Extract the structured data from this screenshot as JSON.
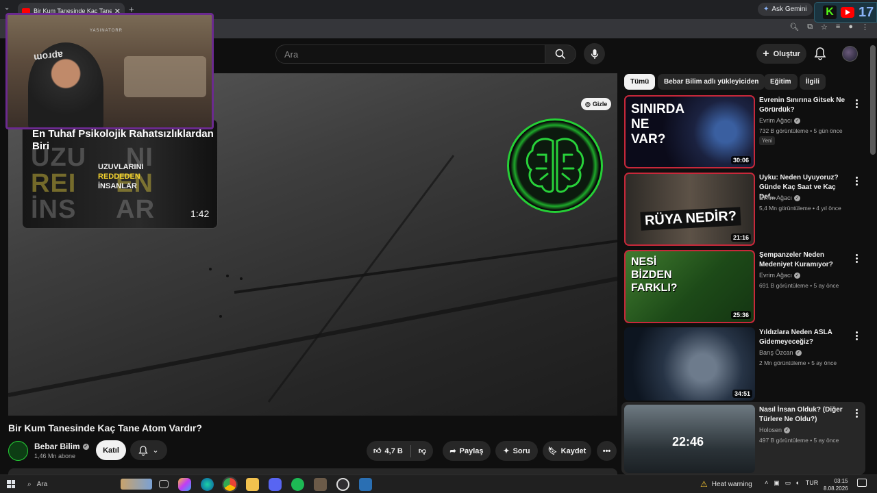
{
  "browser": {
    "tab_title": "Bir Kum Tanesinde Kaç Tane Atom Vardır?",
    "ask_gemini": "Ask Gemini",
    "extension_count": "17"
  },
  "header": {
    "search_placeholder": "Ara",
    "create_label": "Oluştur"
  },
  "player": {
    "hide_label": "Gizle",
    "overlay_card": {
      "title": "En Tuhaf Psikolojik Rahatsızlıklardan Biri",
      "thumb_line1": "UZUVLARINI",
      "thumb_line2": "REDDEDEN",
      "thumb_line3": "İNSANLAR",
      "duration": "1:42"
    },
    "cam_label": "YASINATORR"
  },
  "video": {
    "title": "Bir Kum Tanesinde Kaç Tane Atom Vardır?",
    "channel": "Bebar Bilim",
    "subscribers": "1,46 Mn abone",
    "join_label": "Katıl",
    "likes": "4,7 B",
    "share_label": "Paylaş",
    "ask_label": "Soru",
    "save_label": "Kaydet"
  },
  "chips": [
    "Tümü",
    "Bebar Bilim adlı yükleyiciden",
    "Eğitim",
    "İlgili"
  ],
  "recommendations": [
    {
      "title": "Evrenin Sınırına Gitsek Ne Görürdük?",
      "channel": "Evrim Ağacı",
      "meta": "732 B görüntüleme • 5 gün önce",
      "badge": "Yeni",
      "duration": "30:06",
      "thumb_text": "SINIRDA NE VAR?"
    },
    {
      "title": "Uyku: Neden Uyuyoruz? Günde Kaç Saat ve Kaç Def...",
      "channel": "Evrim Ağacı",
      "meta": "5,4 Mn görüntüleme • 4 yıl önce",
      "duration": "21:16",
      "thumb_text": "RÜYA NEDİR?"
    },
    {
      "title": "Şempanzeler Neden Medeniyet Kuramıyor?",
      "channel": "Evrim Ağacı",
      "meta": "691 B görüntüleme • 5 ay önce",
      "duration": "25:36",
      "thumb_text": "NESİ BİZDEN FARKLI?"
    },
    {
      "title": "Yıldızlara Neden ASLA Gidemeyeceğiz?",
      "channel": "Barış Özcan",
      "meta": "2 Mn görüntüleme • 5 ay önce",
      "duration": "34:51"
    },
    {
      "title": "Nasıl İnsan Olduk? (Diğer Türlere Ne Oldu?)",
      "channel": "Holosen",
      "meta": "497 B görüntüleme • 5 ay önce",
      "duration": "22:46"
    }
  ],
  "taskbar": {
    "search_label": "Ara",
    "weather": "Heat warning",
    "lang": "TUR",
    "time": "03:15",
    "date": "8.08.2026"
  }
}
